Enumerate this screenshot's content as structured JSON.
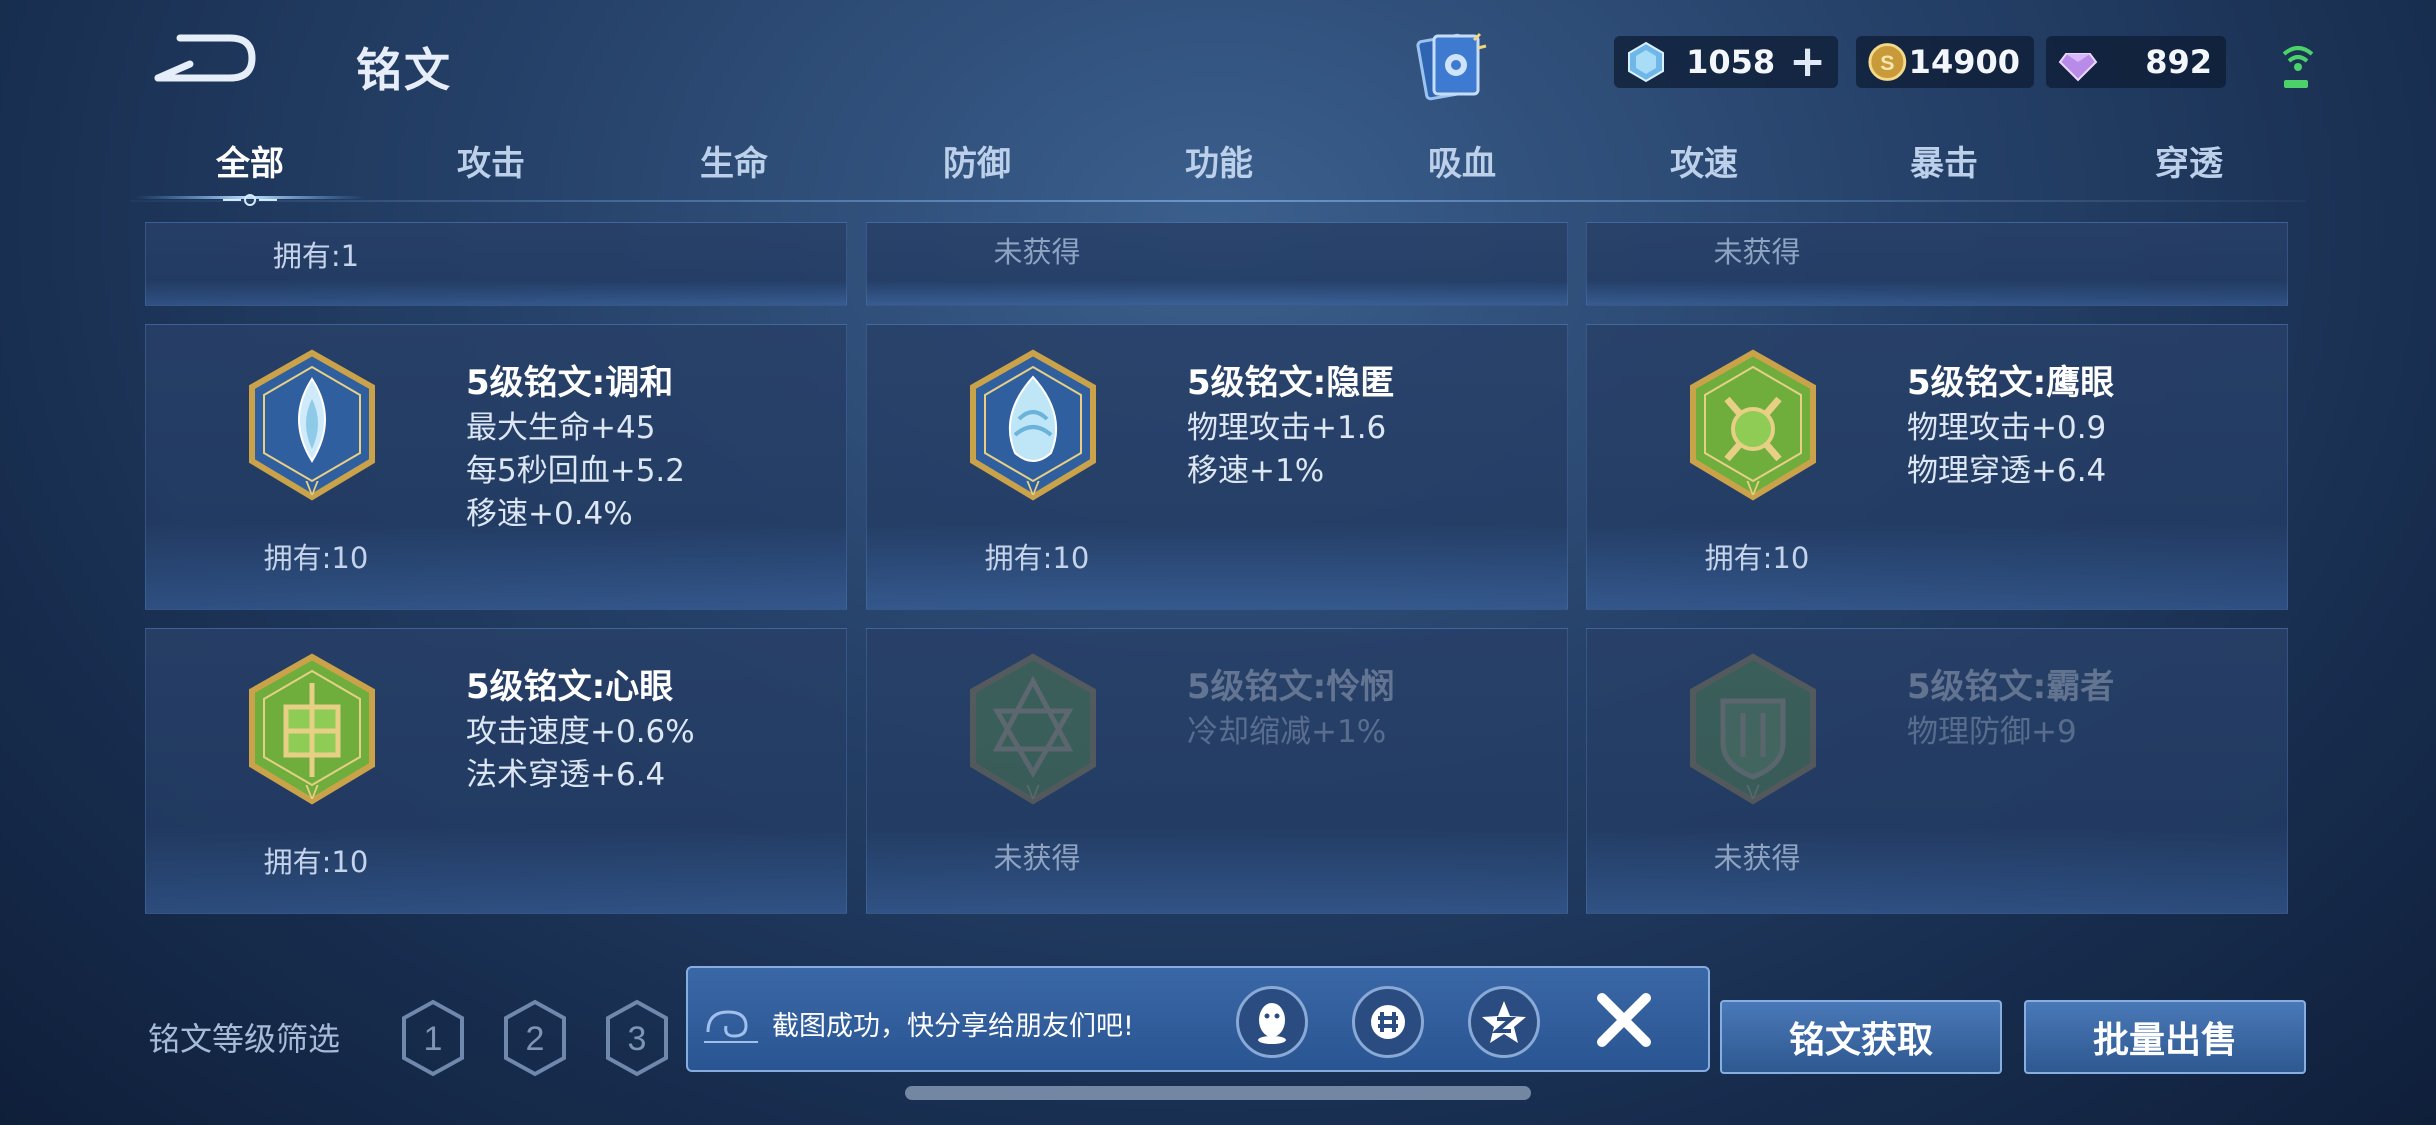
{
  "header": {
    "title": "铭文",
    "currencies": [
      {
        "icon": "diamond-coupon-icon",
        "value": "1058",
        "has_plus": true
      },
      {
        "icon": "gold-coin-icon",
        "value": "14900"
      },
      {
        "icon": "purple-gem-icon",
        "value": "892"
      }
    ]
  },
  "tabs": [
    "全部",
    "攻击",
    "生命",
    "防御",
    "功能",
    "吸血",
    "攻速",
    "暴击",
    "穿透"
  ],
  "active_tab": "全部",
  "top_row": [
    {
      "owned": "拥有:1"
    },
    {
      "owned": "未获得"
    },
    {
      "owned": "未获得"
    }
  ],
  "runes": [
    {
      "name": "5级铭文:调和",
      "attrs": [
        "最大生命+45",
        "每5秒回血+5.2",
        "移速+0.4%"
      ],
      "owned": "拥有:10",
      "color": "blue",
      "obtained": true
    },
    {
      "name": "5级铭文:隐匿",
      "attrs": [
        "物理攻击+1.6",
        "移速+1%"
      ],
      "owned": "拥有:10",
      "color": "blue",
      "obtained": true
    },
    {
      "name": "5级铭文:鹰眼",
      "attrs": [
        "物理攻击+0.9",
        "物理穿透+6.4"
      ],
      "owned": "拥有:10",
      "color": "green",
      "obtained": true
    },
    {
      "name": "5级铭文:心眼",
      "attrs": [
        "攻击速度+0.6%",
        "法术穿透+6.4"
      ],
      "owned": "拥有:10",
      "color": "green",
      "obtained": true
    },
    {
      "name": "5级铭文:怜悯",
      "attrs": [
        "冷却缩减+1%"
      ],
      "owned": "未获得",
      "color": "green",
      "obtained": false
    },
    {
      "name": "5级铭文:霸者",
      "attrs": [
        "物理防御+9"
      ],
      "owned": "未获得",
      "color": "green",
      "obtained": false
    }
  ],
  "bottom": {
    "filter_label": "铭文等级筛选",
    "levels": [
      "1",
      "2",
      "3"
    ],
    "get_button": "铭文获取",
    "sell_button": "批量出售"
  },
  "toast": {
    "message": "截图成功，快分享给朋友们吧!",
    "share_icons": [
      "qq-icon",
      "wechat-moments-icon",
      "qzone-icon"
    ]
  },
  "colors": {
    "accent_blue": "#4a79b8",
    "rune_blue": "#2f5f9e",
    "rune_green": "#6fae3c",
    "gold": "#c9a24a"
  }
}
